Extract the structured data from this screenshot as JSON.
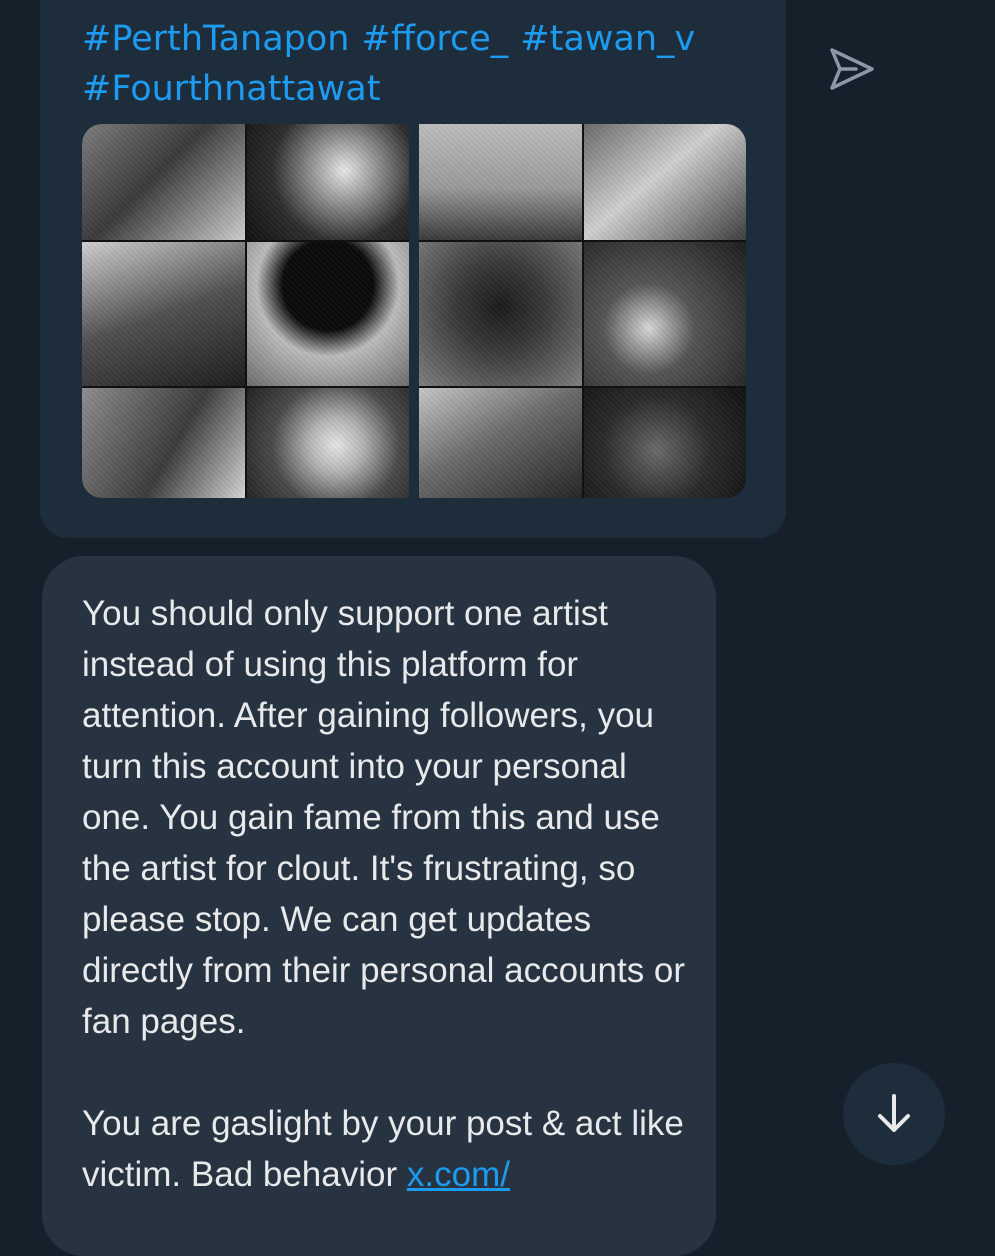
{
  "shared_post": {
    "hashtags_line1": [
      "#PerthTanapon",
      "#fforce_",
      "#tawan_v"
    ],
    "hashtags_line2": [
      "#Fourthnattawat"
    ]
  },
  "message": {
    "paragraph1": "You should only support one artist instead of using this platform for attention. After gaining followers, you turn this account into your personal one. You gain fame from this and use the artist for clout. It's frustrating, so please stop. We can get updates directly from their personal accounts or fan pages.",
    "paragraph2_text": "You are gaslight by your post & act like victim. Bad behavior ",
    "paragraph2_link": "x.com/"
  },
  "colors": {
    "background": "#15202b",
    "incoming_bubble": "#1e2d3c",
    "message_bubble": "#273340",
    "link": "#1d9bf0",
    "text": "#e7e9ea"
  },
  "icons": {
    "send": "send-icon",
    "scroll_down": "arrow-down-icon"
  }
}
